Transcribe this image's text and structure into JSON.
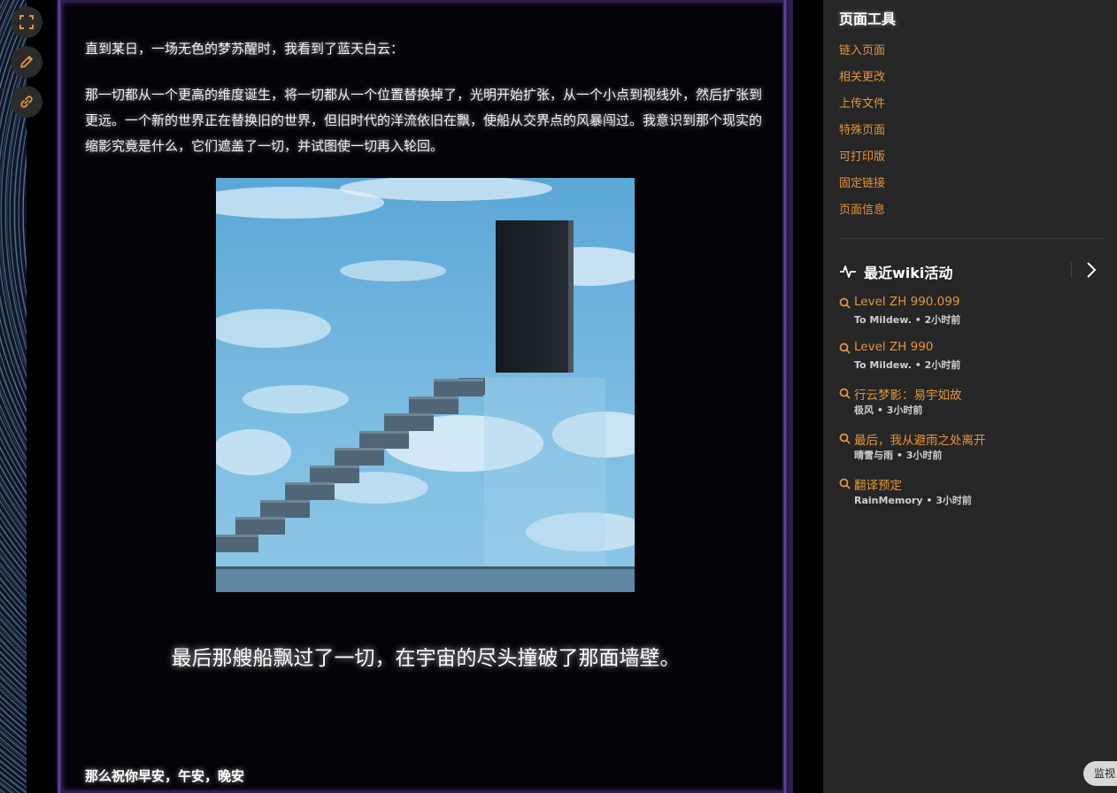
{
  "toolbar": {
    "buttons": [
      {
        "icon": "fullscreen-icon"
      },
      {
        "icon": "pencil-icon"
      },
      {
        "icon": "link-icon"
      }
    ],
    "accent": "#e6963a"
  },
  "article": {
    "paragraph_1": "直到某日，一场无色的梦苏醒时，我看到了蓝天白云：",
    "paragraph_2": "那一切都从一个更高的维度诞生，将一切都从一个位置替换掉了，光明开始扩张，从一个小点到视线外，然后扩张到更远。一个新的世界正在替换旧的世界，但旧时代的洋流依旧在飘，使船从交界点的风暴闯过。我意识到那个现实的缩影究竟是什么，它们遮盖了一切，并试图使一切再入轮回。",
    "caption": "最后那艘船飘过了一切，在宇宙的尽头撞破了那面墙壁。",
    "closing": "那么祝你早安，午安，晚安"
  },
  "sidebar": {
    "page_tools_title": "页面工具",
    "page_tools": [
      "链入页面",
      "相关更改",
      "上传文件",
      "特殊页面",
      "可打印版",
      "固定链接",
      "页面信息"
    ],
    "activity_title": "最近wiki活动",
    "activity": [
      {
        "title": "Level ZH 990.099",
        "meta": "To Mildew. • 2小时前"
      },
      {
        "title": "Level ZH 990",
        "meta": "To Mildew. • 2小时前"
      },
      {
        "title": "行云梦影：易宇如故",
        "meta": "极风 • 3小时前"
      },
      {
        "title": "最后，我从避雨之处离开",
        "meta": "晴雪与雨 • 3小时前"
      },
      {
        "title": "翻译预定",
        "meta": "RainMemory • 3小时前"
      }
    ]
  },
  "monitor_button": "监视"
}
